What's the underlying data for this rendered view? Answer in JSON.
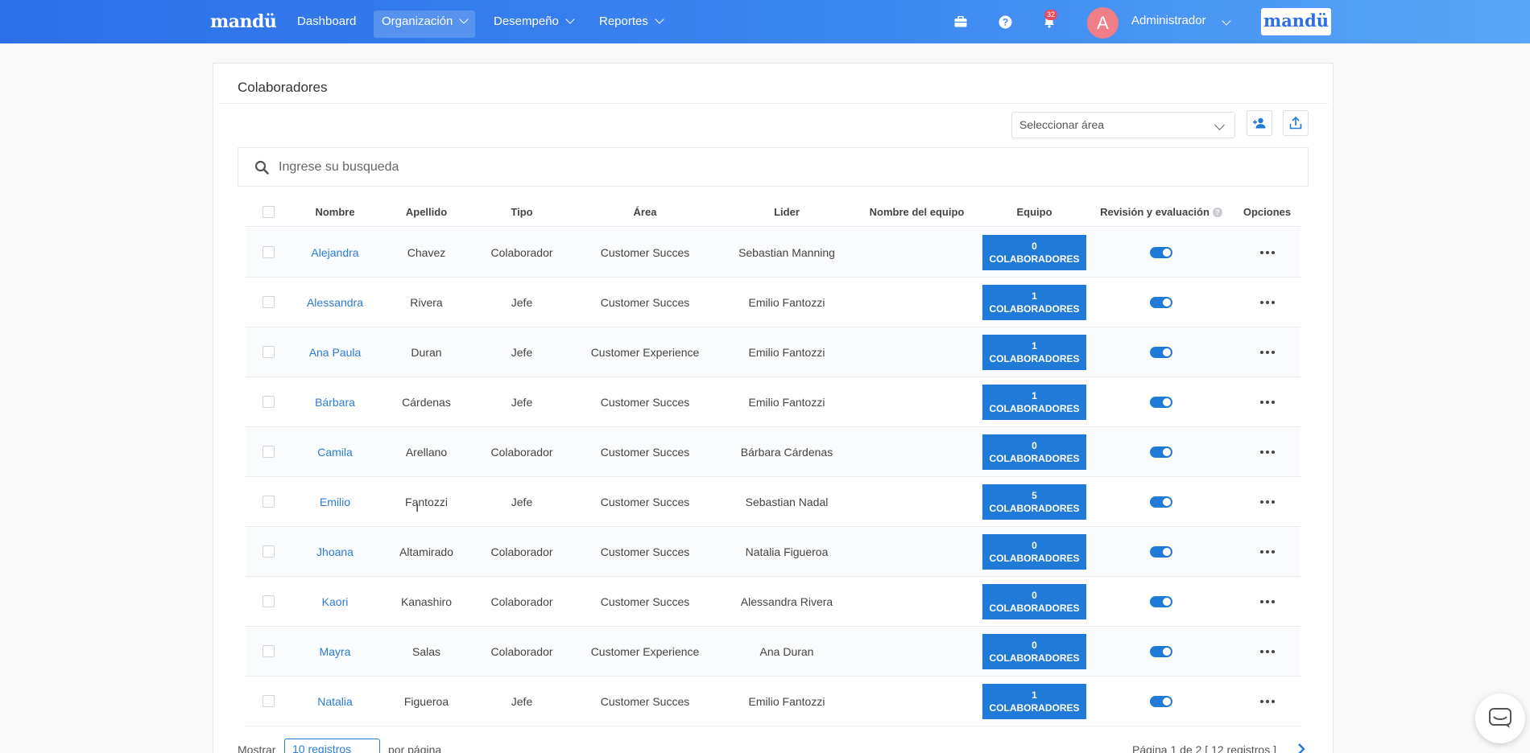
{
  "nav": {
    "brand": "mandü",
    "items": [
      {
        "label": "Dashboard",
        "has_menu": false,
        "active": false
      },
      {
        "label": "Organización",
        "has_menu": true,
        "active": true
      },
      {
        "label": "Desempeño",
        "has_menu": true,
        "active": false
      },
      {
        "label": "Reportes",
        "has_menu": true,
        "active": false
      }
    ],
    "icons": [
      "briefcase-icon",
      "help-icon",
      "bell-icon"
    ],
    "notification_count": "32",
    "avatar_initial": "A",
    "user_name": "Administrador",
    "logo_text": "mandü"
  },
  "page": {
    "title": "Colaboradores",
    "area_select_placeholder": "Seleccionar área",
    "search_placeholder": "Ingrese su busqueda"
  },
  "table": {
    "columns": [
      "Nombre",
      "Apellido",
      "Tipo",
      "Área",
      "Lider",
      "Nombre del equipo",
      "Equipo",
      "Revisión y evaluación",
      "Opciones"
    ],
    "team_unit": "COLABORADORES",
    "rows": [
      {
        "nombre": "Alejandra",
        "apellido": "Chavez",
        "tipo": "Colaborador",
        "area": "Customer Succes",
        "lider": "Sebastian Manning",
        "nombre_equipo": "",
        "equipo": "0",
        "revision": true
      },
      {
        "nombre": "Alessandra",
        "apellido": "Rivera",
        "tipo": "Jefe",
        "area": "Customer Succes",
        "lider": "Emilio Fantozzi",
        "nombre_equipo": "",
        "equipo": "1",
        "revision": true
      },
      {
        "nombre": "Ana Paula",
        "apellido": "Duran",
        "tipo": "Jefe",
        "area": "Customer Experience",
        "lider": "Emilio Fantozzi",
        "nombre_equipo": "",
        "equipo": "1",
        "revision": true
      },
      {
        "nombre": "Bárbara",
        "apellido": "Cárdenas",
        "tipo": "Jefe",
        "area": "Customer Succes",
        "lider": "Emilio Fantozzi",
        "nombre_equipo": "",
        "equipo": "1",
        "revision": true
      },
      {
        "nombre": "Camila",
        "apellido": "Arellano",
        "tipo": "Colaborador",
        "area": "Customer Succes",
        "lider": "Bárbara Cárdenas",
        "nombre_equipo": "",
        "equipo": "0",
        "revision": true
      },
      {
        "nombre": "Emilio",
        "apellido": "Fantozzi",
        "tipo": "Jefe",
        "area": "Customer Succes",
        "lider": "Sebastian Nadal",
        "nombre_equipo": "",
        "equipo": "5",
        "revision": true
      },
      {
        "nombre": "Jhoana",
        "apellido": "Altamirado",
        "tipo": "Colaborador",
        "area": "Customer Succes",
        "lider": "Natalia Figueroa",
        "nombre_equipo": "",
        "equipo": "0",
        "revision": true
      },
      {
        "nombre": "Kaori",
        "apellido": "Kanashiro",
        "tipo": "Colaborador",
        "area": "Customer Succes",
        "lider": "Alessandra Rivera",
        "nombre_equipo": "",
        "equipo": "0",
        "revision": true
      },
      {
        "nombre": "Mayra",
        "apellido": "Salas",
        "tipo": "Colaborador",
        "area": "Customer Experience",
        "lider": "Ana Duran",
        "nombre_equipo": "",
        "equipo": "0",
        "revision": true
      },
      {
        "nombre": "Natalia",
        "apellido": "Figueroa",
        "tipo": "Jefe",
        "area": "Customer Succes",
        "lider": "Emilio Fantozzi",
        "nombre_equipo": "",
        "equipo": "1",
        "revision": true
      }
    ]
  },
  "footer": {
    "show_label": "Mostrar",
    "per_page_value": "10 registros",
    "per_page_label": "por página",
    "page_info": "Página 1 de 2 [ 12 registros ]"
  },
  "colors": {
    "nav_gradient_start": "#2d6fe8",
    "nav_gradient_end": "#58a6f7",
    "accent": "#1f7ad8",
    "link": "#2b7cd3",
    "avatar": "#ef7e86",
    "badge": "#e84a5f"
  }
}
